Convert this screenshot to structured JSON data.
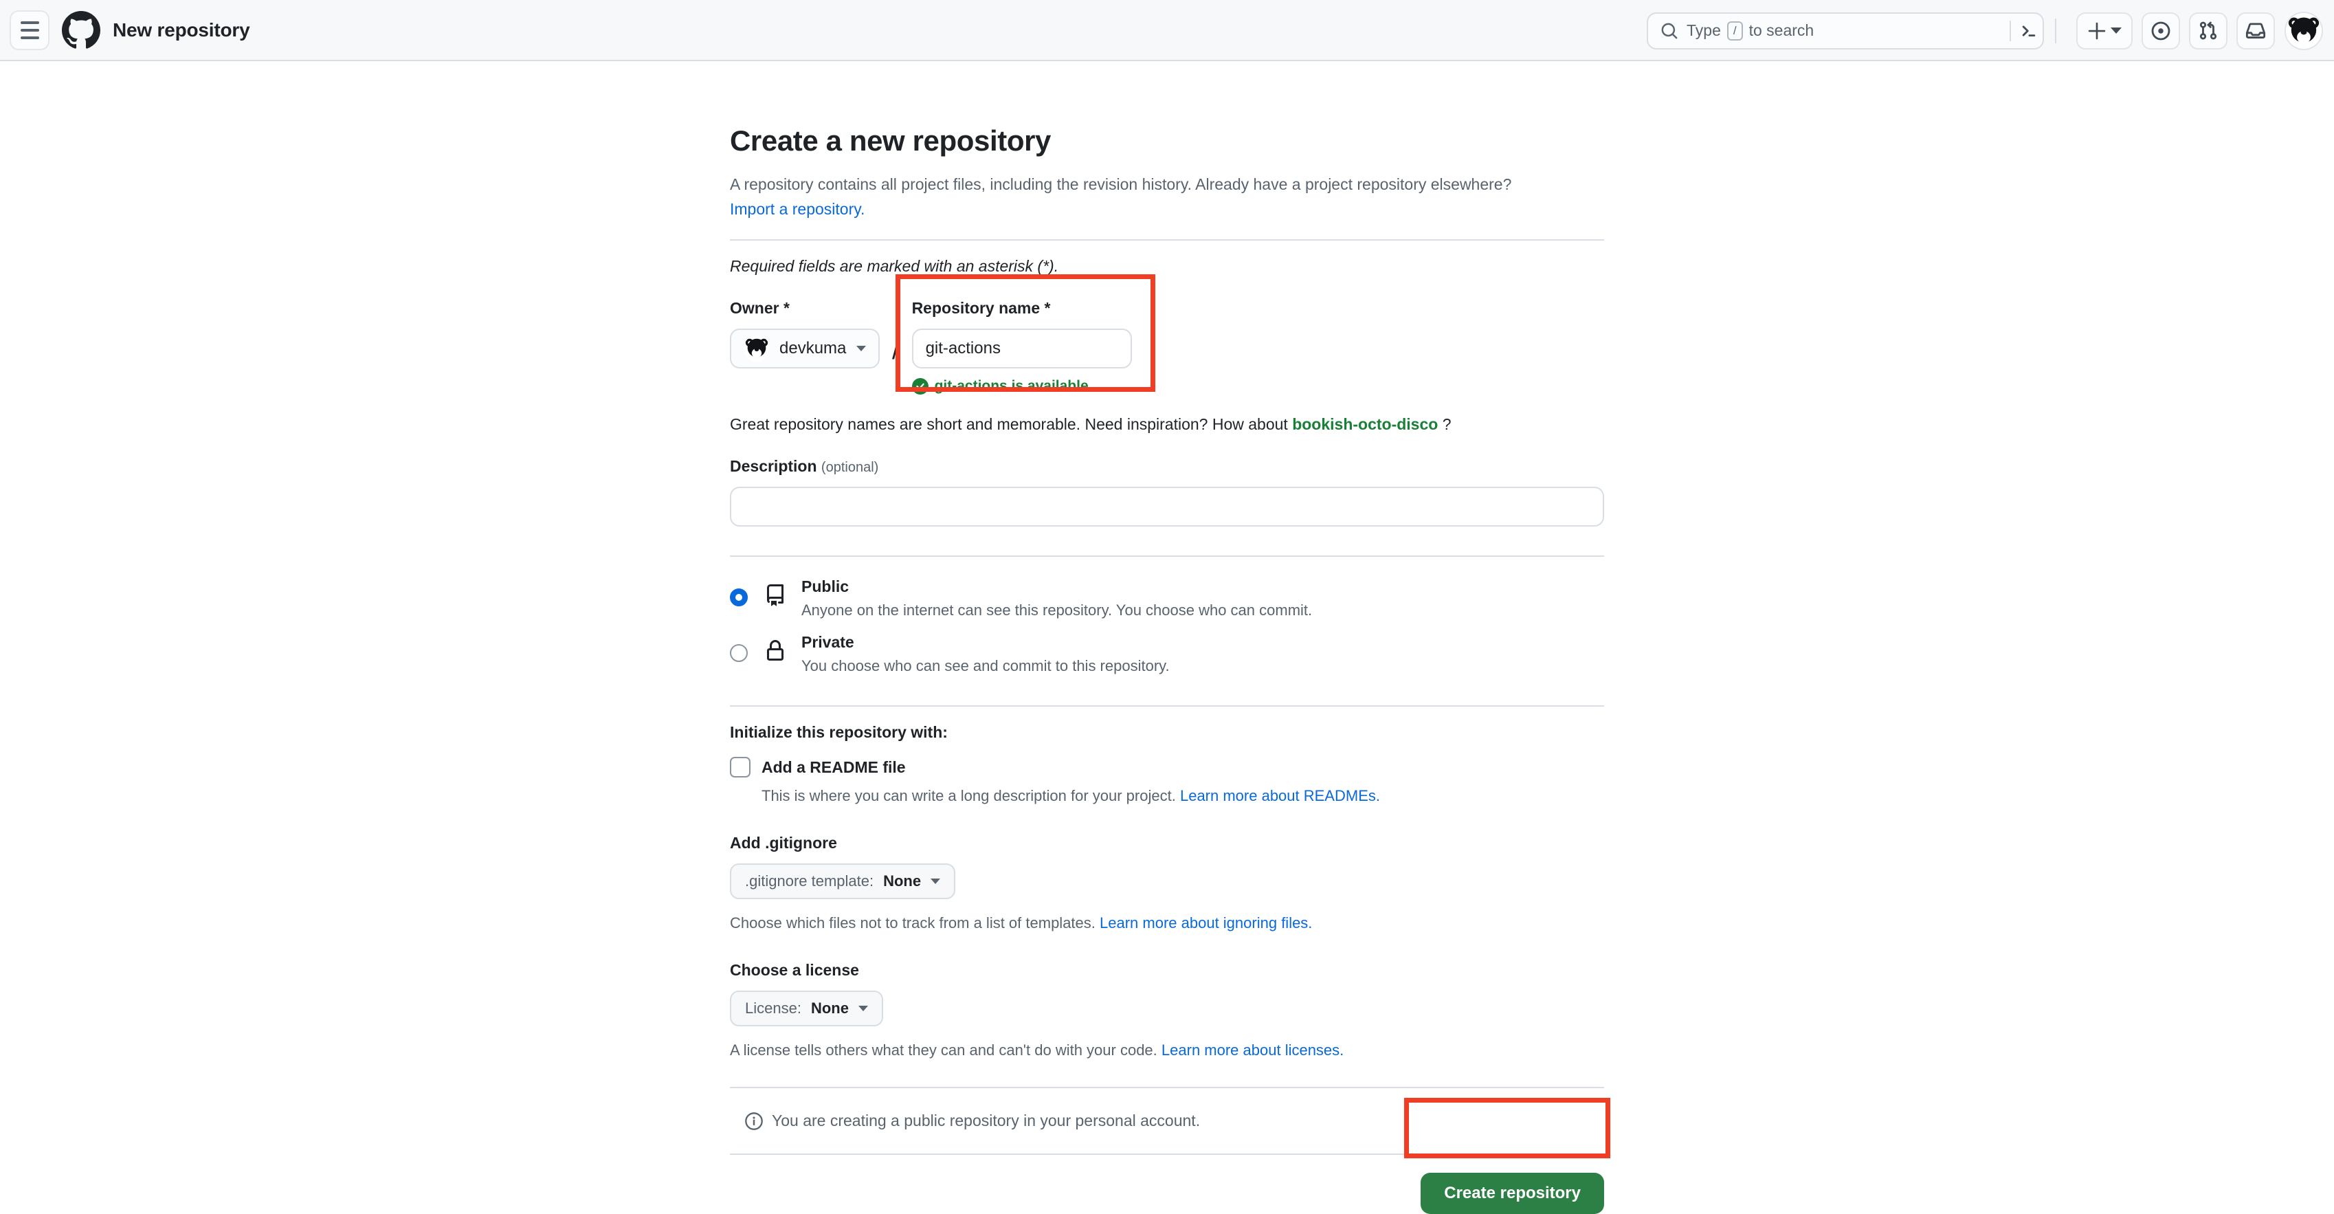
{
  "header": {
    "menu_icon": "hamburger-icon",
    "logo_icon": "github-logo-icon",
    "title": "New repository",
    "search": {
      "icon": "search-icon",
      "placeholder_prefix": "Type",
      "placeholder_key": "/",
      "placeholder_suffix": "to search",
      "terminal_icon": "terminal-icon"
    },
    "actions": [
      {
        "name": "create-new-menu",
        "icon": "plus-icon",
        "has_caret": true
      },
      {
        "name": "issues",
        "icon": "issue-opened-icon"
      },
      {
        "name": "pull-requests",
        "icon": "git-pull-request-icon"
      },
      {
        "name": "notifications",
        "icon": "inbox-icon"
      }
    ],
    "avatar": {
      "name": "user-avatar",
      "alt": "devkuma"
    }
  },
  "main": {
    "title": "Create a new repository",
    "lede_part1": "A repository contains all project files, including the revision history. Already have a project repository elsewhere?",
    "lede_link": "Import a repository.",
    "required_note": "Required fields are marked with an asterisk (*).",
    "owner": {
      "label": "Owner *",
      "value": "devkuma",
      "avatar_icon": "bear-avatar-icon",
      "caret_icon": "chevron-down-icon"
    },
    "separator": "/",
    "repository_name": {
      "label": "Repository name *",
      "value": "git-actions",
      "placeholder": "",
      "availability_icon": "check-circle-fill-icon",
      "availability_text": "git-actions is available."
    },
    "name_hint": {
      "prefix": "Great repository names are short and memorable. Need inspiration? How about",
      "suggestion": "bookish-octo-disco",
      "suffix": "?"
    },
    "description": {
      "label": "Description",
      "optional": "(optional)",
      "value": "",
      "placeholder": ""
    },
    "visibility": {
      "options": [
        {
          "id": "public",
          "name": "Public",
          "icon": "repo-icon",
          "description": "Anyone on the internet can see this repository. You choose who can commit.",
          "selected": true
        },
        {
          "id": "private",
          "name": "Private",
          "icon": "lock-icon",
          "description": "You choose who can see and commit to this repository.",
          "selected": false
        }
      ]
    },
    "initialize": {
      "heading": "Initialize this repository with:",
      "readme": {
        "label": "Add a README file",
        "checked": false,
        "description_prefix": "This is where you can write a long description for your project.",
        "description_link": "Learn more about READMEs."
      }
    },
    "gitignore": {
      "heading": "Add .gitignore",
      "button_prefix": ".gitignore template:",
      "button_value": "None",
      "caret_icon": "chevron-down-icon",
      "note_prefix": "Choose which files not to track from a list of templates.",
      "note_link": "Learn more about ignoring files."
    },
    "license": {
      "heading": "Choose a license",
      "button_prefix": "License:",
      "button_value": "None",
      "caret_icon": "chevron-down-icon",
      "note_prefix": "A license tells others what they can and can't do with your code.",
      "note_link": "Learn more about licenses."
    },
    "footer_info": {
      "icon": "info-icon",
      "text": "You are creating a public repository in your personal account."
    },
    "submit": {
      "label": "Create repository"
    }
  },
  "annotations": {
    "accent_color": "#ef3e24",
    "boxes": [
      {
        "name": "repository-name-highlight"
      },
      {
        "name": "create-repository-highlight"
      }
    ]
  },
  "colors": {
    "brand_green": "#2c8045",
    "link_blue": "#0969da",
    "success_green": "#1a7f37",
    "header_bg": "#f6f8fa",
    "border": "#d8dee4",
    "text": "#1f2328",
    "muted": "#59636e"
  }
}
